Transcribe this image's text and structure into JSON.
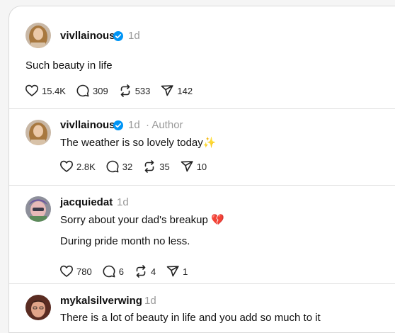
{
  "posts": [
    {
      "username": "vivllainous",
      "verified": true,
      "time": "1d",
      "text": "Such beauty in life",
      "likes": "15.4K",
      "replies": "309",
      "reposts": "533",
      "shares": "142"
    },
    {
      "username": "vivllainous",
      "verified": true,
      "time": "1d",
      "author_tag": "· Author",
      "text": "The weather is so lovely today",
      "emoji": "✨",
      "likes": "2.8K",
      "replies": "32",
      "reposts": "35",
      "shares": "10"
    },
    {
      "username": "jacquiedat",
      "time": "1d",
      "text": "Sorry about your dad's breakup",
      "emoji": "💔",
      "text2": "During pride month no less.",
      "likes": "780",
      "replies": "6",
      "reposts": "4",
      "shares": "1"
    },
    {
      "username": "mykalsilverwing",
      "time": "1d",
      "text": "There is a lot of beauty in life and you add so much to it"
    }
  ],
  "colors": {
    "verified": "#0095f6",
    "muted": "#999999",
    "heart_emoji": "#d8356b",
    "sparkle_emoji": "#f5b942"
  },
  "icons": [
    "heart-icon",
    "comment-icon",
    "repost-icon",
    "share-icon",
    "verified-badge-icon"
  ]
}
